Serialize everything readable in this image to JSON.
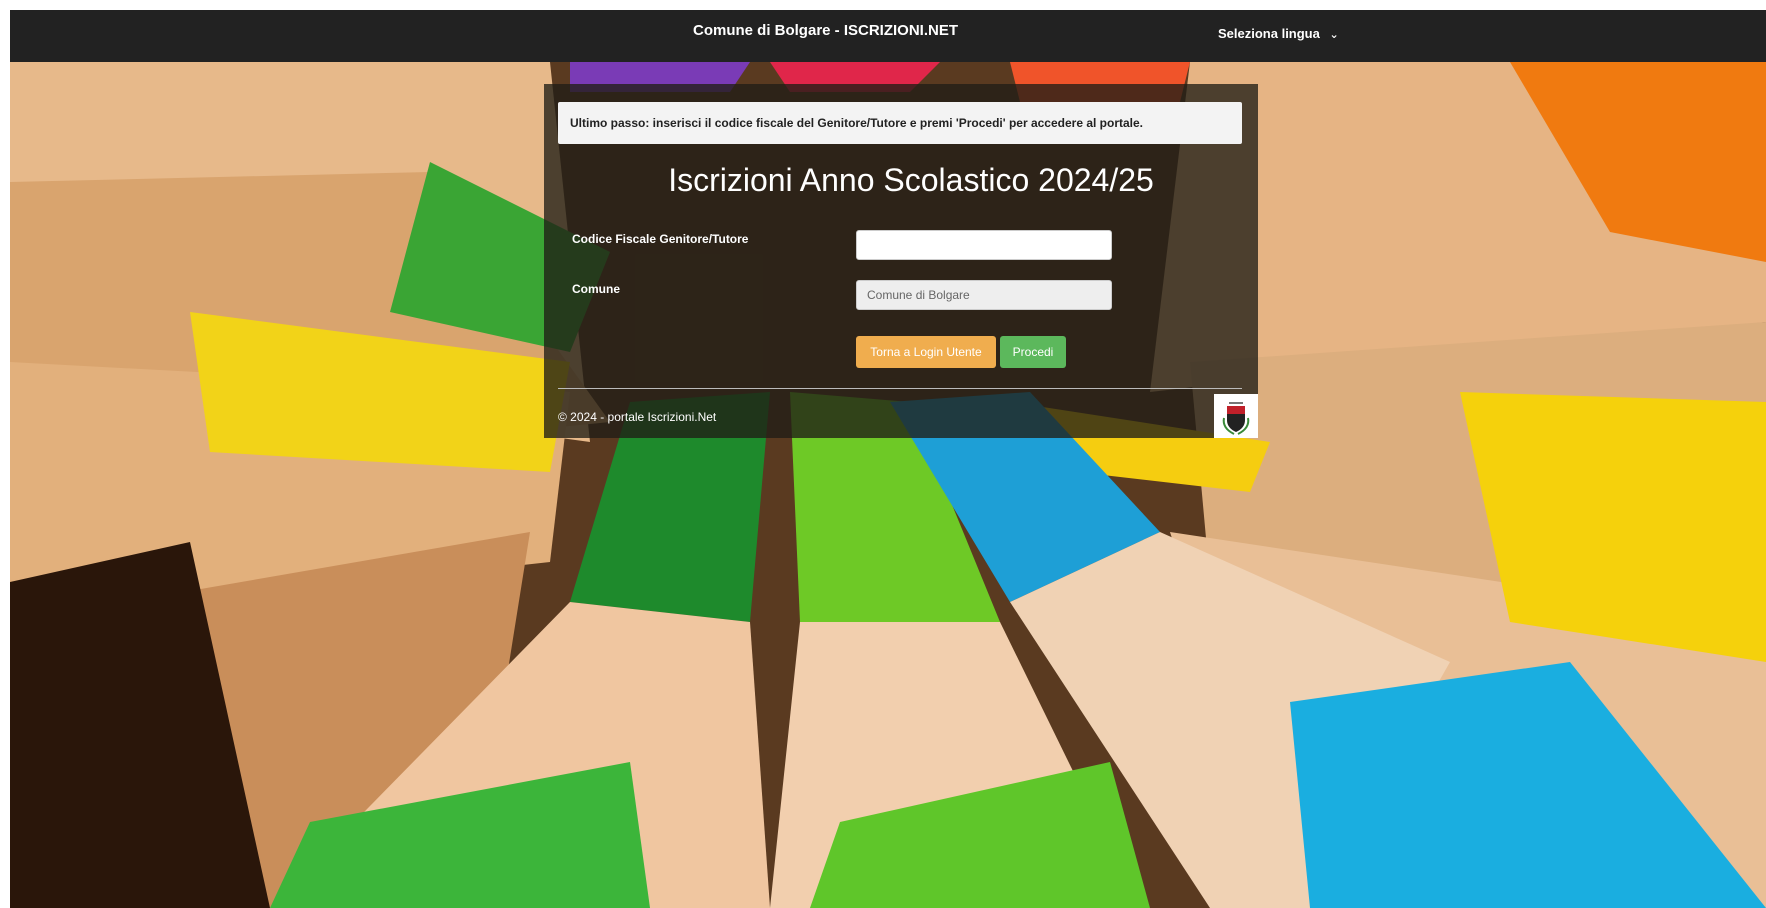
{
  "header": {
    "title": "Comune di Bolgare - ISCRIZIONI.NET",
    "language_label": "Seleziona lingua"
  },
  "panel": {
    "notice": "Ultimo passo: inserisci il codice fiscale del Genitore/Tutore e premi 'Procedi' per accedere al portale.",
    "title": "Iscrizioni Anno Scolastico 2024/25",
    "fields": {
      "codice_fiscale_label": "Codice Fiscale Genitore/Tutore",
      "codice_fiscale_value": "",
      "comune_label": "Comune",
      "comune_value": "Comune di Bolgare"
    },
    "buttons": {
      "back_label": "Torna a Login Utente",
      "proceed_label": "Procedi"
    },
    "footer": "© 2024 - portale Iscrizioni.Net"
  },
  "colors": {
    "topbar": "#222222",
    "back_button": "#f0ad4e",
    "proceed_button": "#5cb85c"
  },
  "icons": {
    "language": "chevron-down-icon",
    "crest": "coat-of-arms-icon"
  }
}
